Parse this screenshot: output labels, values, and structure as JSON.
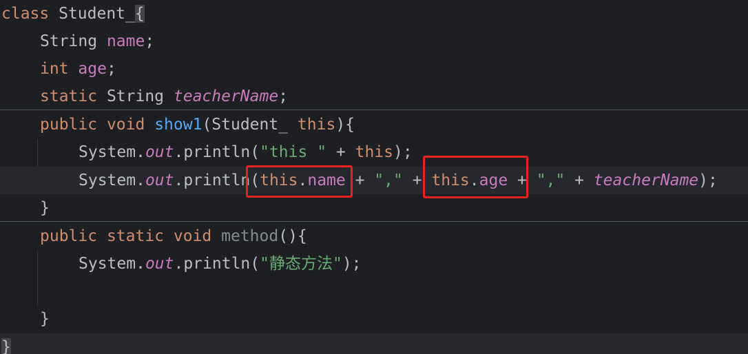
{
  "code": {
    "l1": {
      "kw": "class",
      "name": " Student_",
      "brace": "{"
    },
    "l2": {
      "type": "String",
      "field": "name",
      "end": ";"
    },
    "l3": {
      "kw": "int",
      "field": "age",
      "end": ";"
    },
    "l4": {
      "kw": "static",
      "type": " String ",
      "field": "teacherName",
      "end": ";"
    },
    "l5": {
      "kw1": "public",
      "kw2": " void ",
      "method": "show1",
      "params1": "(Student_ ",
      "this_kw": "this",
      "params2": "){"
    },
    "l6": {
      "sys": "System.",
      "out": "out",
      "call": ".println(",
      "str": "\"this \"",
      "plus": " + ",
      "this_kw": "this",
      "end": ");"
    },
    "l7": {
      "sys": "System.",
      "out": "out",
      "call": ".println(",
      "this1": "this",
      "dot1": ".",
      "f1": "name",
      "p1": " + ",
      "s1": "\",\"",
      "p2": " + ",
      "this2": "this",
      "dot2": ".",
      "f2": "age",
      "p3": " + ",
      "s2": "\",\"",
      "p4": " + ",
      "f3": "teacherName",
      "end": ");"
    },
    "l8": {
      "brace": "}"
    },
    "l9": {
      "kw1": "public",
      "kw2": " static ",
      "kw3": "void ",
      "method": "method",
      "end": "(){"
    },
    "l10": {
      "sys": "System.",
      "out": "out",
      "call": ".println(",
      "str": "\"静态方法\"",
      "end": ");"
    },
    "l12": {
      "brace": "}"
    },
    "l13": {
      "brace": "}"
    }
  }
}
